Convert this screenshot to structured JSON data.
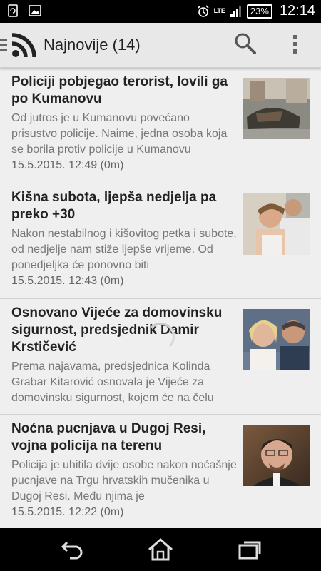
{
  "status_bar": {
    "network": "LTE",
    "battery": "23%",
    "time": "12:14",
    "icons": [
      "sync-screen-icon",
      "image-icon",
      "alarm-icon",
      "signal-icon"
    ]
  },
  "app_bar": {
    "title": "Najnovije (14)",
    "icons": [
      "drawer-icon",
      "rss-icon",
      "search-icon",
      "overflow-menu-icon"
    ]
  },
  "articles": [
    {
      "title": "Policiji pobjegao terorist, lovili ga po Kumanovu",
      "summary": "Od jutros je u Kumanovu povećano prisustvo policije. Naime, jedna osoba koja se borila protiv policije u Kumanovu",
      "date": "15.5.2015. 12:49 (0m)"
    },
    {
      "title": "Kišna subota, ljepša nedjelja pa preko +30",
      "summary": "Nakon nestabilnog i kišovitog petka i subote, od nedjelje nam stiže ljepše vrijeme. Od ponedjeljka će ponovno biti",
      "date": "15.5.2015. 12:43 (0m)"
    },
    {
      "title": "Osnovano Vijeće za domovinsku sigurnost, predsjednik Damir Krstičević",
      "summary": "Prema najavama, predsjednica Kolinda Grabar Kitarović osnovala je Vijeće za domovinsku sigurnost, kojem će na čelu",
      "date": "15.5.2015. 12:38 (0m)"
    },
    {
      "title": "Noćna pucnjava u Dugoj Resi, vojna policija na terenu",
      "summary": "Policija je uhitila dvije osobe nakon noćašnje pucnjave na Trgu hrvatskih mučenika u Dugoj Resi. Među njima je",
      "date": "15.5.2015. 12:22 (0m)"
    }
  ],
  "nav_bar": {
    "icons": [
      "back-icon",
      "home-icon",
      "recent-apps-icon"
    ]
  }
}
